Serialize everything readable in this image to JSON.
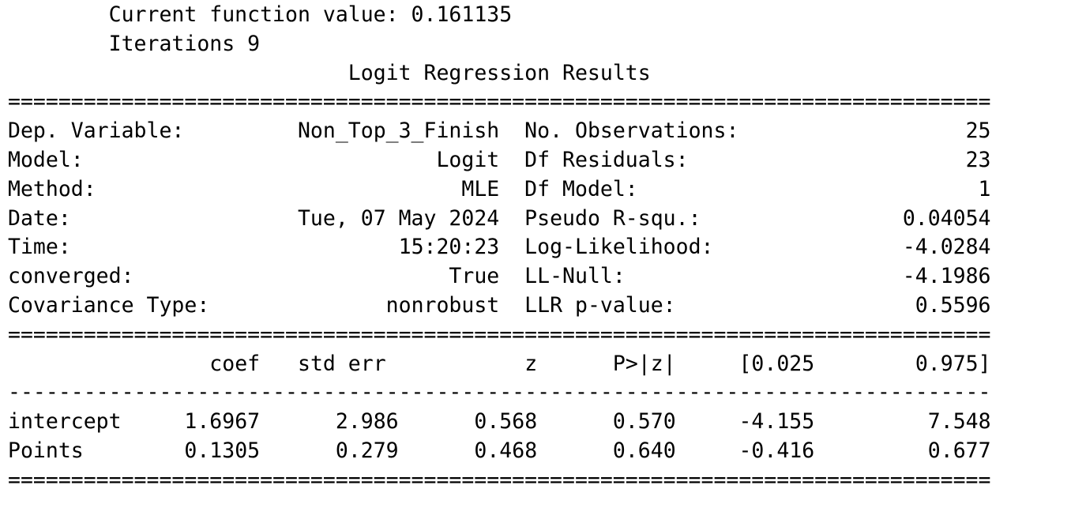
{
  "preamble": {
    "function_value_line": "Current function value: 0.161135",
    "iterations_line": "Iterations 9"
  },
  "title": "Logit Regression Results",
  "rule_major_char": "=",
  "rule_minor_char": "-",
  "summary_rows": [
    {
      "left_label": "Dep. Variable:",
      "left_value": "Non_Top_3_Finish",
      "right_label": "No. Observations:",
      "right_value": "25"
    },
    {
      "left_label": "Model:",
      "left_value": "Logit",
      "right_label": "Df Residuals:",
      "right_value": "23"
    },
    {
      "left_label": "Method:",
      "left_value": "MLE",
      "right_label": "Df Model:",
      "right_value": "1"
    },
    {
      "left_label": "Date:",
      "left_value": "Tue, 07 May 2024",
      "right_label": "Pseudo R-squ.:",
      "right_value": "0.04054"
    },
    {
      "left_label": "Time:",
      "left_value": "15:20:23",
      "right_label": "Log-Likelihood:",
      "right_value": "-4.0284"
    },
    {
      "left_label": "converged:",
      "left_value": "True",
      "right_label": "LL-Null:",
      "right_value": "-4.1986"
    },
    {
      "left_label": "Covariance Type:",
      "left_value": "nonrobust",
      "right_label": "LLR p-value:",
      "right_value": "0.5596"
    }
  ],
  "coef_header": [
    "",
    "coef",
    "std err",
    "z",
    "P>|z|",
    "[0.025",
    "0.975]"
  ],
  "coef_rows": [
    {
      "name": "intercept",
      "coef": "1.6967",
      "std_err": "2.986",
      "z": "0.568",
      "p": "0.570",
      "ci_low": "-4.155",
      "ci_high": "7.548"
    },
    {
      "name": "Points",
      "coef": "0.1305",
      "std_err": "0.279",
      "z": "0.468",
      "p": "0.640",
      "ci_low": "-0.416",
      "ci_high": "0.677"
    }
  ]
}
